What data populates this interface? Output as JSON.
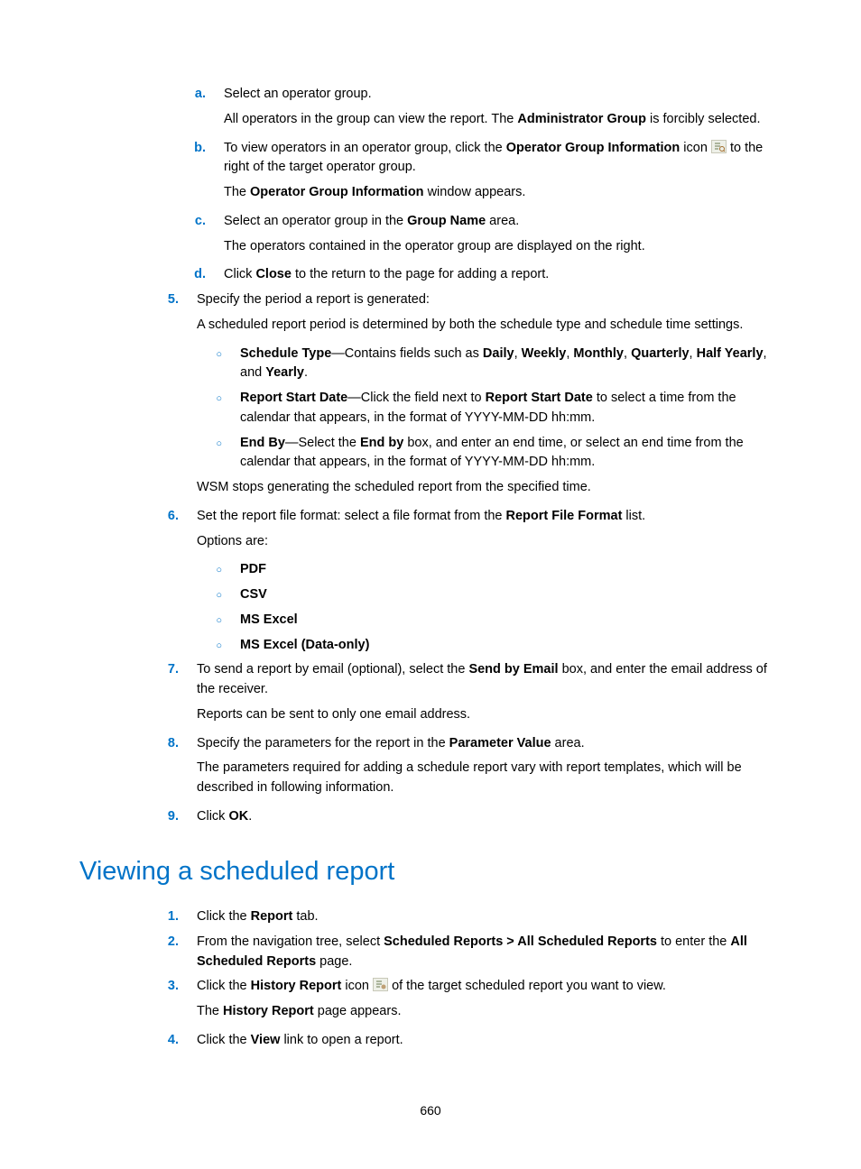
{
  "steps_a": {
    "a": {
      "label": "a.",
      "text1": "Select an operator group.",
      "text2a": "All operators in the group can view the report. The ",
      "bold2": "Administrator Group",
      "text2b": " is forcibly selected."
    },
    "b": {
      "label": "b.",
      "text1a": "To view operators in an operator group, click the ",
      "bold1": "Operator Group Information",
      "text1b": " icon ",
      "text1c": " to the right of the target operator group.",
      "text2a": "The ",
      "bold2": "Operator Group Information",
      "text2b": " window appears."
    },
    "c": {
      "label": "c.",
      "text1a": "Select an operator group in the ",
      "bold1": "Group Name",
      "text1b": " area.",
      "text2": "The operators contained in the operator group are displayed on the right."
    },
    "d": {
      "label": "d.",
      "text1a": "Click ",
      "bold1": "Close",
      "text1b": " to the return to the page for adding a report."
    }
  },
  "step5": {
    "label": "5.",
    "text1": "Specify the period a report is generated:",
    "text2": "A scheduled report period is determined by both the schedule type and schedule time settings.",
    "bullet1": {
      "circ": "○",
      "b1": "Schedule Type",
      "t1": "—Contains fields such as ",
      "b2": "Daily",
      "c1": ", ",
      "b3": "Weekly",
      "c2": ", ",
      "b4": "Monthly",
      "c3": ", ",
      "b5": "Quarterly",
      "c4": ", ",
      "b6": "Half Yearly",
      "c5": ", and ",
      "b7": "Yearly",
      "c6": "."
    },
    "bullet2": {
      "circ": "○",
      "b1": "Report Start Date",
      "t1": "—Click the field next to ",
      "b2": "Report Start Date",
      "t2": " to select a time from the calendar that appears, in the format of YYYY-MM-DD hh:mm."
    },
    "bullet3": {
      "circ": "○",
      "b1": "End By",
      "t1": "—Select the ",
      "b2": "End by",
      "t2": " box, and enter an end time, or select an end time from the calendar that appears, in the format of YYYY-MM-DD hh:mm."
    },
    "text3": "WSM stops generating the scheduled report from the specified time."
  },
  "step6": {
    "label": "6.",
    "t1a": "Set the report file format: select a file format from the ",
    "b1": "Report File Format",
    "t1b": " list.",
    "t2": "Options are:",
    "opt1": {
      "circ": "○",
      "b": "PDF"
    },
    "opt2": {
      "circ": "○",
      "b": "CSV"
    },
    "opt3": {
      "circ": "○",
      "b": "MS Excel"
    },
    "opt4": {
      "circ": "○",
      "b": "MS Excel (Data-only)"
    }
  },
  "step7": {
    "label": "7.",
    "t1a": "To send a report by email (optional), select the ",
    "b1": "Send by Email",
    "t1b": " box, and enter the email address of the receiver.",
    "t2": "Reports can be sent to only one email address."
  },
  "step8": {
    "label": "8.",
    "t1a": "Specify the parameters for the report in the ",
    "b1": "Parameter Value",
    "t1b": " area.",
    "t2": "The parameters required for adding a schedule report vary with report templates, which will be described in following information."
  },
  "step9": {
    "label": "9.",
    "t1a": "Click ",
    "b1": "OK",
    "t1b": "."
  },
  "heading": "Viewing a scheduled report",
  "v1": {
    "label": "1.",
    "t1a": "Click the ",
    "b1": "Report",
    "t1b": " tab."
  },
  "v2": {
    "label": "2.",
    "t1a": "From the navigation tree, select ",
    "b1": "Scheduled Reports > All Scheduled Reports",
    "t1b": " to enter the ",
    "b2": "All Scheduled Reports",
    "t1c": " page."
  },
  "v3": {
    "label": "3.",
    "t1a": "Click the ",
    "b1": "History Report",
    "t1b": " icon ",
    "t1c": " of the target scheduled report you want to view.",
    "t2a": "The ",
    "b2": "History Report",
    "t2b": " page appears."
  },
  "v4": {
    "label": "4.",
    "t1a": "Click the ",
    "b1": "View",
    "t1b": " link to open a report."
  },
  "pageNumber": "660"
}
